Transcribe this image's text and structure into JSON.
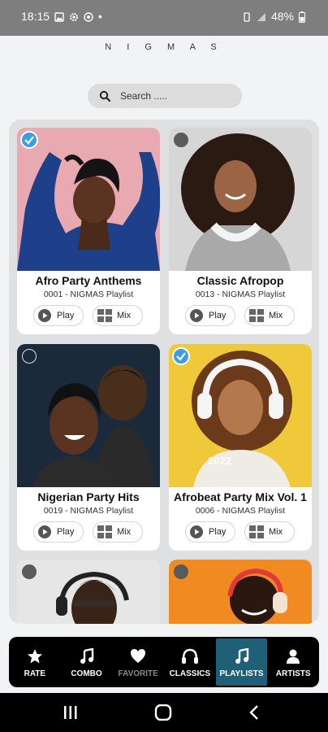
{
  "status": {
    "time": "18:15",
    "battery": "48%",
    "dot": "•"
  },
  "brand": "N I G M A S",
  "search": {
    "placeholder": "Search ....."
  },
  "cards": [
    {
      "title": "Afro Party Anthems",
      "subtitle": "0001 - NIGMAS Playlist",
      "play": "Play",
      "mix": "Mix",
      "checked": true
    },
    {
      "title": "Classic Afropop",
      "subtitle": "0013 - NIGMAS Playlist",
      "play": "Play",
      "mix": "Mix",
      "checked": false
    },
    {
      "title": "Nigerian Party Hits",
      "subtitle": "0019 - NIGMAS Playlist",
      "play": "Play",
      "mix": "Mix",
      "checked": false
    },
    {
      "title": "Afrobeat Party Mix Vol. 1",
      "subtitle": "0006 - NIGMAS Playlist",
      "play": "Play",
      "mix": "Mix",
      "checked": true,
      "overlay_text": "2022"
    }
  ],
  "nav": [
    {
      "label": "RATE",
      "icon": "star-icon"
    },
    {
      "label": "COMBO",
      "icon": "music-note-icon"
    },
    {
      "label": "FAVORITE",
      "icon": "heart-icon"
    },
    {
      "label": "CLASSICS",
      "icon": "headphones-icon"
    },
    {
      "label": "PLAYLISTS",
      "icon": "music-note-icon"
    },
    {
      "label": "ARTISTS",
      "icon": "person-icon"
    }
  ],
  "colors": {
    "accent": "#3a9ee0",
    "active_tab": "#1f5f78",
    "status_bar": "#7e7e7e"
  }
}
